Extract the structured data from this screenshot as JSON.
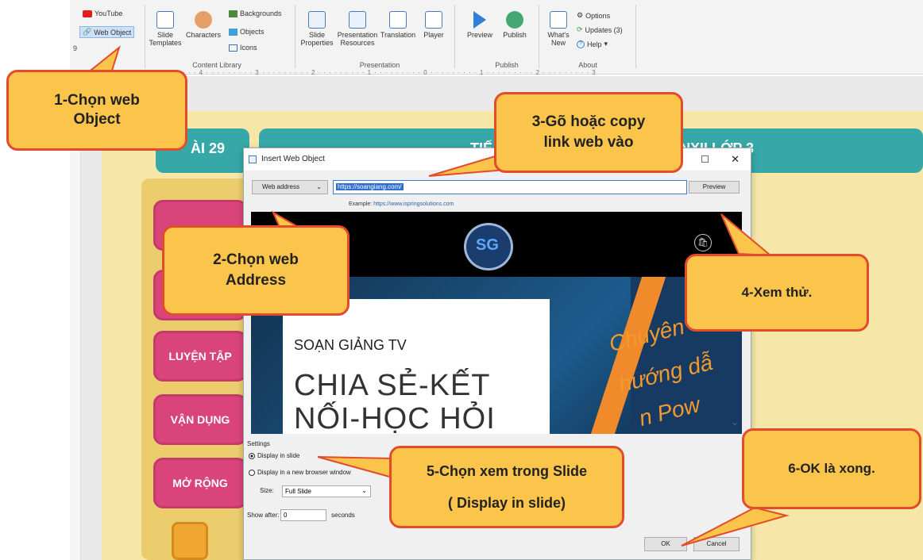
{
  "ribbon": {
    "youtube": "YouTube",
    "web_object": "Web Object",
    "slide_templates": "Slide Templates",
    "characters": "Characters",
    "backgrounds": "Backgrounds",
    "objects": "Objects",
    "icons": "Icons",
    "group_content_library": "Content Library",
    "slide_properties": "Slide Properties",
    "presentation_resources": "Presentation Resources",
    "translation": "Translation",
    "player": "Player",
    "group_presentation": "Presentation",
    "preview": "Preview",
    "publish": "Publish",
    "group_publish": "Publish",
    "whats_new": "What's New",
    "options": "Options",
    "updates": "Updates (3)",
    "help": "Help",
    "group_about": "About",
    "left_num": "9"
  },
  "ruler": "5 · · · · · · · · · 4 · · · · · · · · · 3 · · · · · · · · · 2 · · · · · · · · · 1 · · · · · · · · · 0 · · · · · · · · · 1 · · · · · · · · · 2 · · · · · · · · · 3",
  "slide": {
    "lesson_tag": "ÀI 29",
    "title_fragment_left": "TIẾ",
    "title_fragment_right": "NXII LỚP 3",
    "buttons": [
      "LUYỆN TẬP",
      "VẬN DỤNG",
      "MỞ RỘNG"
    ]
  },
  "dialog": {
    "title": "Insert Web Object",
    "address_type": "Web address",
    "url": "https://soangiang.com/",
    "preview_button": "Preview",
    "example_label": "Example:",
    "example_url": "https://www.ispringsolutions.com",
    "settings_label": "Settings",
    "display_in_slide": "Display in slide",
    "display_in_browser": "Display in a new browser window",
    "size_label": "Size:",
    "size_value": "Full Slide",
    "show_after_label": "Show after:",
    "show_after_value": "0",
    "seconds_label": "seconds",
    "ok": "OK",
    "cancel": "Cancel"
  },
  "web_preview": {
    "brand": "SOẠN GIẢNG TV",
    "headline1": "CHIA SẺ-KẾT",
    "headline2": "NỐI-HỌC HỎI",
    "script1": "Chuyên",
    "script2": "hướng dẫ",
    "script3": "n Pow"
  },
  "callouts": {
    "c1": [
      "1-Chọn web",
      "Object"
    ],
    "c2": [
      "2-Chọn web",
      "Address"
    ],
    "c3": [
      "3-Gõ hoặc copy",
      "link web vào"
    ],
    "c4": [
      "4-Xem thử."
    ],
    "c5": [
      "5-Chọn xem trong Slide",
      "( Display in slide)"
    ],
    "c6": [
      "6-OK là xong."
    ]
  },
  "colors": {
    "callout_fill": "#fbc54b",
    "callout_border": "#e24c2c",
    "slide_bg": "#f6e7a8",
    "teal": "#37a8a8",
    "pink": "#d9457a"
  }
}
